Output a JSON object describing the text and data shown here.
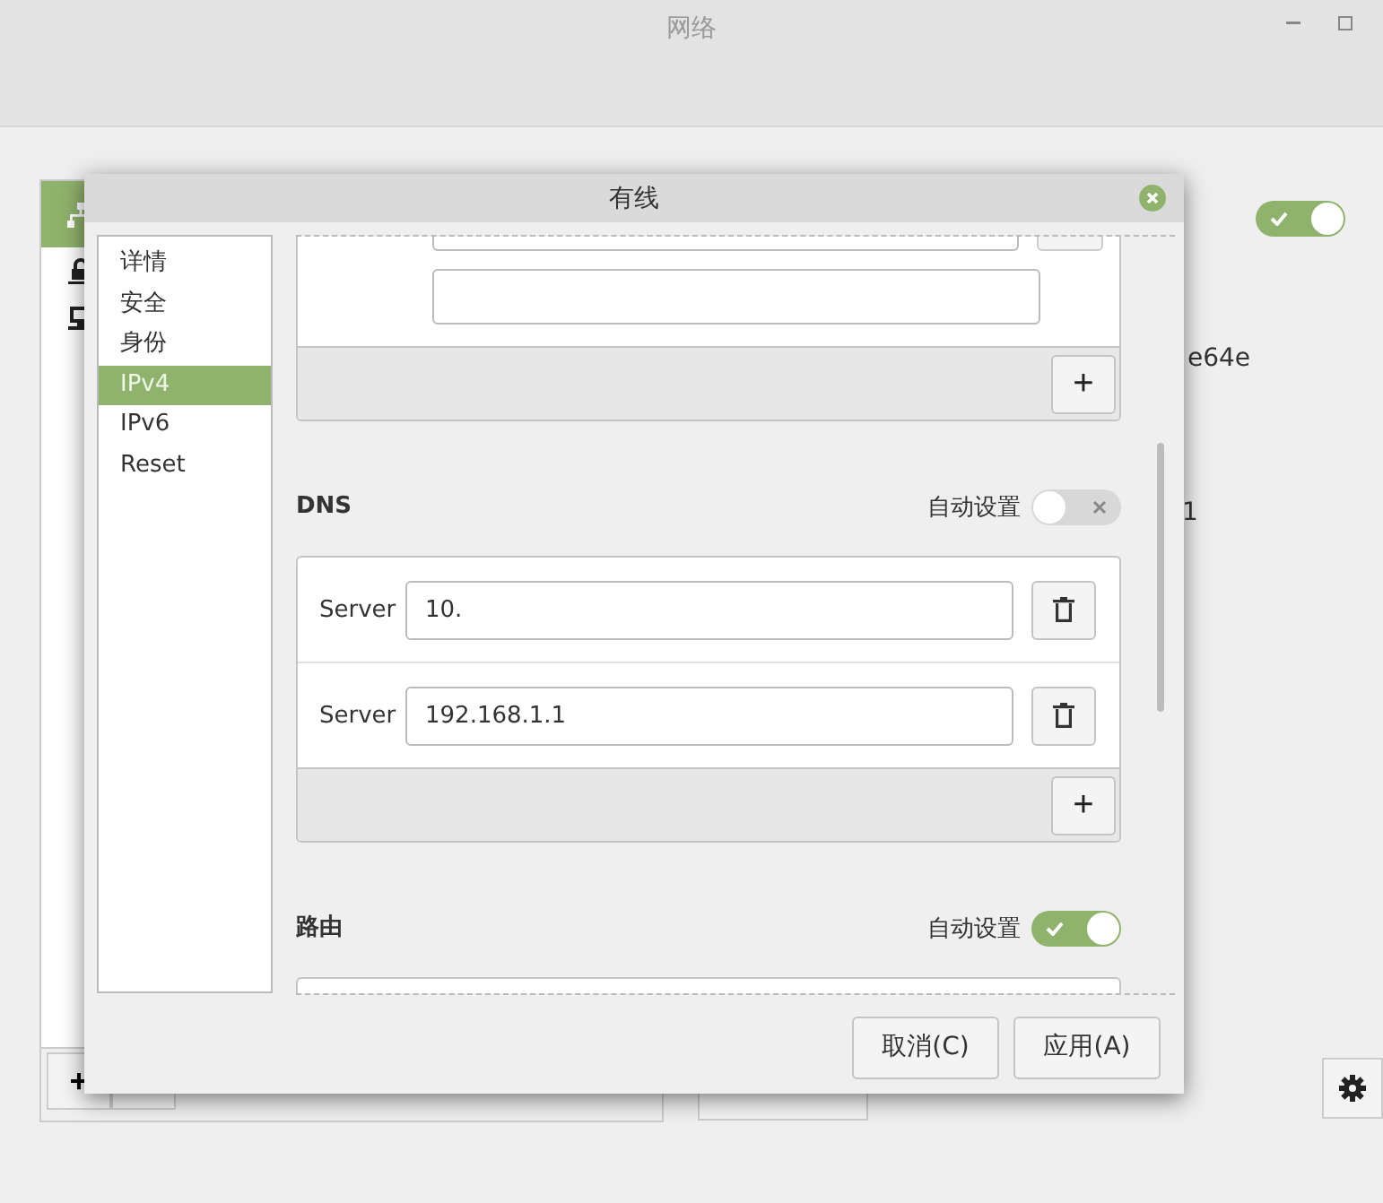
{
  "window": {
    "title": "网络"
  },
  "connection_list": {
    "items": [
      {
        "kind": "wired",
        "selected": true
      },
      {
        "kind": "vpn",
        "selected": false
      },
      {
        "kind": "proxy",
        "selected": false
      }
    ],
    "add_button": "+"
  },
  "main_toggle": {
    "on": true
  },
  "details": [
    "e64e",
    "1"
  ],
  "dialog": {
    "title": "有线",
    "sidebar": [
      {
        "label": "详情",
        "selected": false
      },
      {
        "label": "安全",
        "selected": false
      },
      {
        "label": "身份",
        "selected": false
      },
      {
        "label": "IPv4",
        "selected": true
      },
      {
        "label": "IPv6",
        "selected": false
      },
      {
        "label": "Reset",
        "selected": false
      }
    ],
    "add_button": "+",
    "dns": {
      "heading": "DNS",
      "auto_label": "自动设置",
      "auto": false,
      "servers": [
        {
          "label": "Server",
          "value": "10."
        },
        {
          "label": "Server",
          "value": "192.168.1.1"
        }
      ],
      "add_button": "+"
    },
    "routes": {
      "heading": "路由",
      "auto_label": "自动设置",
      "auto": true
    },
    "buttons": [
      "取消(C)",
      "应用(A)"
    ]
  }
}
